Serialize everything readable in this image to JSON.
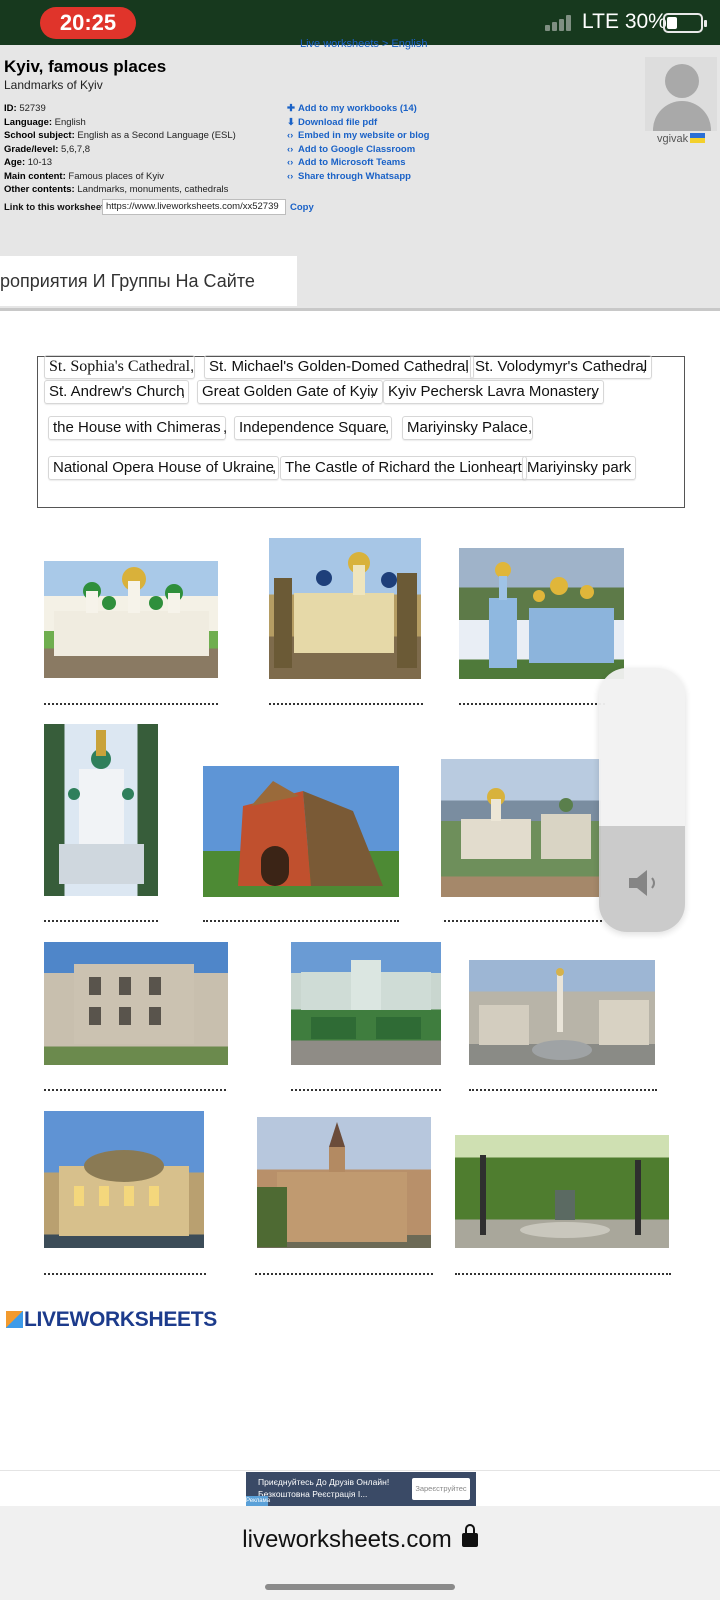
{
  "status_bar": {
    "time": "20:25",
    "network": "LTE",
    "battery": "30%",
    "battery_level": 0.3
  },
  "breadcrumb": "Live worksheets > English",
  "worksheet": {
    "title": "Kyiv, famous places",
    "subtitle": "Landmarks of Kyiv",
    "meta": [
      {
        "label": "ID:",
        "value": "52739"
      },
      {
        "label": "Language:",
        "value": "English"
      },
      {
        "label": "School subject:",
        "value": "English as a Second Language (ESL)"
      },
      {
        "label": "Grade/level:",
        "value": "5,6,7,8"
      },
      {
        "label": "Age:",
        "value": "10-13"
      },
      {
        "label": "Main content:",
        "value": "Famous places of Kyiv"
      },
      {
        "label": "Other contents:",
        "value": "Landmarks, monuments, cathedrals"
      }
    ],
    "link_label": "Link to this worksheet:",
    "link_url": "https://www.liveworksheets.com/xx52739",
    "copy_label": "Copy"
  },
  "actions": [
    {
      "icon": "add-workbook-icon",
      "label": "Add to my workbooks (14)"
    },
    {
      "icon": "download-icon",
      "label": "Download file pdf"
    },
    {
      "icon": "embed-icon",
      "label": "Embed in my website or blog"
    },
    {
      "icon": "google-classroom-icon",
      "label": "Add to Google Classroom"
    },
    {
      "icon": "microsoft-teams-icon",
      "label": "Add to Microsoft Teams"
    },
    {
      "icon": "whatsapp-icon",
      "label": "Share through Whatsapp"
    }
  ],
  "user": {
    "name": "vgivak"
  },
  "groups_banner": "роприятия И Группы На Сайте",
  "word_bank": [
    "St. Sophia's Cathedral",
    "St. Michael's Golden-Domed Cathedral",
    "St. Volodymyr's Cathedral",
    "St. Andrew's Church",
    "Great Golden Gate of Kyiv",
    "Kyiv Pechersk Lavra Monastery",
    "the House with Chimeras",
    "Independence Square",
    "Mariyinsky Palace",
    "National  Opera House of Ukraine",
    "The Castle of Richard the Lionheart",
    "Mariyinsky park"
  ],
  "volume": {
    "level": 0.4,
    "icon": "speaker-icon"
  },
  "logo_text": "LIVEWORKSHEETS",
  "ad": {
    "line1": "Приєднуйтесь До Друзів Онлайн!",
    "line2": "Безкоштовна Реєстрація І...",
    "button": "Зареєструйтес",
    "tag": "Реклама"
  },
  "browser": {
    "url": "liveworksheets.com"
  },
  "colors": {
    "status_bar": "#17391e",
    "time_pill": "#e0342b",
    "link_blue": "#1a62c7",
    "header_bg": "#e6e6e6",
    "logo_blue": "#1c3b8c"
  }
}
